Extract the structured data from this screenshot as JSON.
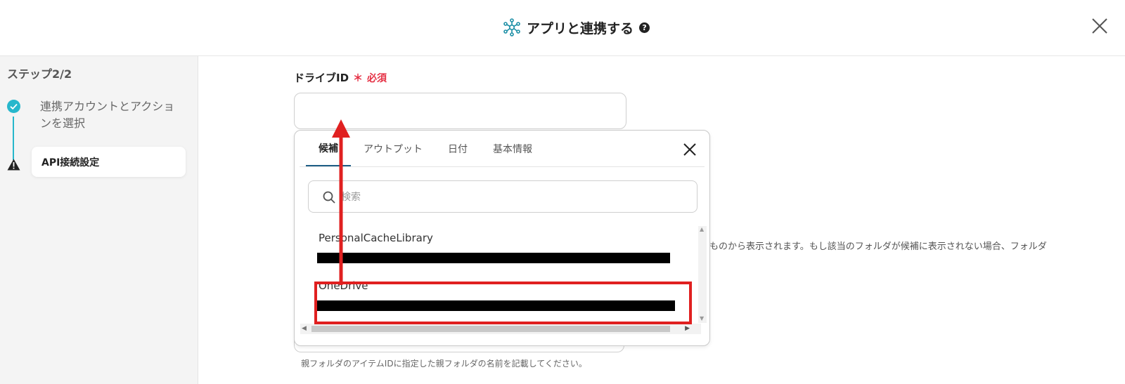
{
  "header": {
    "title": "アプリと連携する",
    "help": "?",
    "icon": "network-hub-icon"
  },
  "sidebar": {
    "step_count": "ステップ2/2",
    "steps": [
      {
        "label": "連携アカウントとアクションを選択",
        "status": "done",
        "icon": "check-circle-icon"
      },
      {
        "label": "API接続設定",
        "status": "warning",
        "icon": "warning-triangle-icon"
      }
    ]
  },
  "form": {
    "drive_id_label": "ドライブID",
    "required_mark": "＊",
    "required_text": "必須",
    "drive_id_value": "",
    "description_partial": "ものから表示されます。もし該当のフォルダが候補に表示されない場合、フォルダ",
    "bottom_help": "親フォルダのアイテムIDに指定した親フォルダの名前を記載してください。"
  },
  "popover": {
    "tabs": [
      "候補",
      "アウトプット",
      "日付",
      "基本情報"
    ],
    "active_tab": "候補",
    "search_placeholder": "検索",
    "items": [
      {
        "name": "PersonalCacheLibrary",
        "redacted": true
      },
      {
        "name": "OneDrive",
        "redacted": true,
        "highlighted": true
      }
    ]
  },
  "colors": {
    "accent_teal": "#27b7cc",
    "tab_underline": "#1d5e86",
    "required_red": "#e53145",
    "annotation_red": "#e02020"
  }
}
